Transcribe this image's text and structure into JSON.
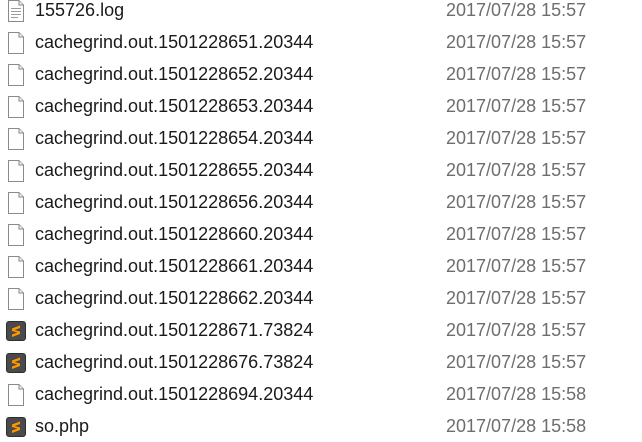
{
  "files": [
    {
      "name": "155726.log",
      "modified": "2017/07/28 15:57",
      "icon": "text-file-icon"
    },
    {
      "name": "cachegrind.out.1501228651.20344",
      "modified": "2017/07/28 15:57",
      "icon": "blank-file-icon"
    },
    {
      "name": "cachegrind.out.1501228652.20344",
      "modified": "2017/07/28 15:57",
      "icon": "blank-file-icon"
    },
    {
      "name": "cachegrind.out.1501228653.20344",
      "modified": "2017/07/28 15:57",
      "icon": "blank-file-icon"
    },
    {
      "name": "cachegrind.out.1501228654.20344",
      "modified": "2017/07/28 15:57",
      "icon": "blank-file-icon"
    },
    {
      "name": "cachegrind.out.1501228655.20344",
      "modified": "2017/07/28 15:57",
      "icon": "blank-file-icon"
    },
    {
      "name": "cachegrind.out.1501228656.20344",
      "modified": "2017/07/28 15:57",
      "icon": "blank-file-icon"
    },
    {
      "name": "cachegrind.out.1501228660.20344",
      "modified": "2017/07/28 15:57",
      "icon": "blank-file-icon"
    },
    {
      "name": "cachegrind.out.1501228661.20344",
      "modified": "2017/07/28 15:57",
      "icon": "blank-file-icon"
    },
    {
      "name": "cachegrind.out.1501228662.20344",
      "modified": "2017/07/28 15:57",
      "icon": "blank-file-icon"
    },
    {
      "name": "cachegrind.out.1501228671.73824",
      "modified": "2017/07/28 15:57",
      "icon": "sublime-text-icon"
    },
    {
      "name": "cachegrind.out.1501228676.73824",
      "modified": "2017/07/28 15:57",
      "icon": "sublime-text-icon"
    },
    {
      "name": "cachegrind.out.1501228694.20344",
      "modified": "2017/07/28 15:58",
      "icon": "blank-file-icon"
    },
    {
      "name": "so.php",
      "modified": "2017/07/28 15:58",
      "icon": "sublime-text-icon"
    }
  ],
  "colors": {
    "name_text": "#1a1a1a",
    "date_text": "#6d6d6d",
    "sublime_orange": "#ff9800",
    "sublime_dark": "#4a4a4a"
  }
}
